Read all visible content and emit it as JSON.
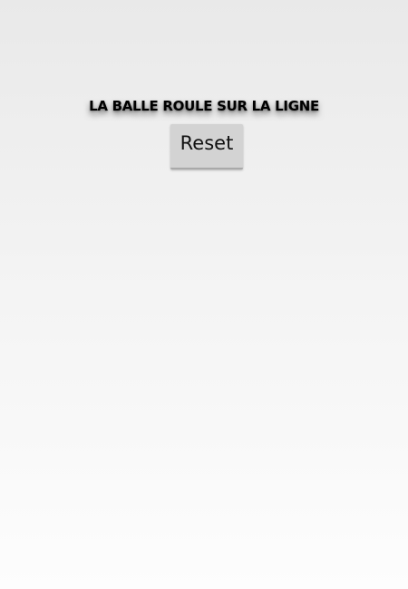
{
  "app": {
    "title": "LA BALLE ROULE SUR LA LIGNE"
  },
  "controls": {
    "reset_label": "Reset"
  },
  "colors": {
    "background_top": "#e9e9e9",
    "background_bottom": "#fdfdfd",
    "button_bg": "#d3d3d3",
    "title_text": "#000000"
  }
}
